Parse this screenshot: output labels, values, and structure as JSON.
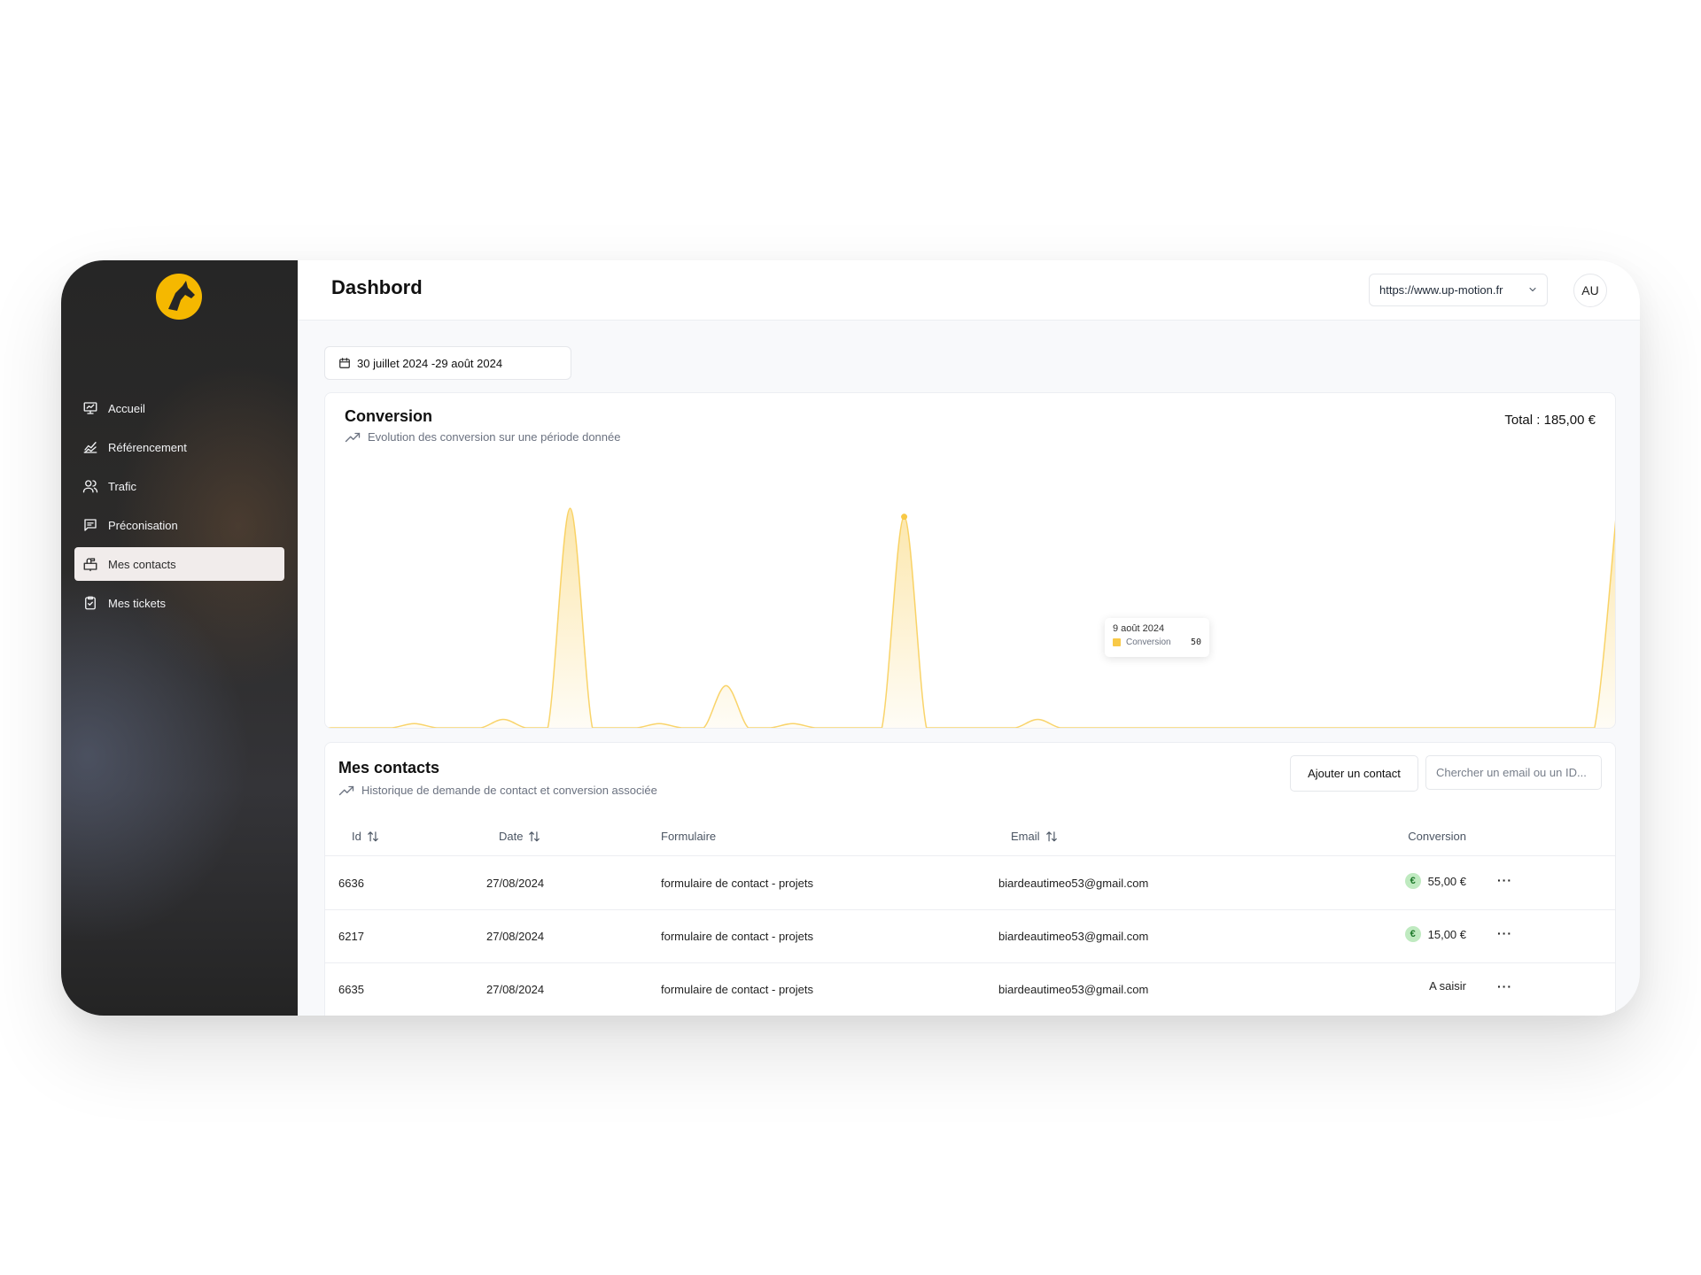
{
  "sidebar": {
    "items": [
      {
        "label": "Accueil",
        "icon": "presentation-icon"
      },
      {
        "label": "Référencement",
        "icon": "chart-line-icon"
      },
      {
        "label": "Trafic",
        "icon": "users-icon"
      },
      {
        "label": "Préconisation",
        "icon": "message-icon"
      },
      {
        "label": "Mes contacts",
        "icon": "mailbox-icon",
        "active": true
      },
      {
        "label": "Mes tickets",
        "icon": "clipboard-icon"
      }
    ]
  },
  "header": {
    "title": "Dashbord",
    "site_select": "https://www.up-motion.fr",
    "avatar": "AU"
  },
  "date_range": "30 juillet 2024 -29 août 2024",
  "conversion": {
    "title": "Conversion",
    "subtitle": "Evolution des conversion sur une période donnée",
    "total": "Total : 185,00 €",
    "tooltip": {
      "date": "9 août 2024",
      "label": "Conversion",
      "value": "50"
    }
  },
  "chart_data": {
    "type": "area",
    "series": [
      {
        "values": [
          0,
          0,
          0,
          0,
          1,
          0,
          0,
          0,
          2,
          0,
          0,
          52,
          0,
          0,
          0,
          1,
          0,
          0,
          10,
          0,
          0,
          1,
          0,
          0,
          0,
          0,
          50,
          0,
          0,
          0,
          0,
          0,
          2,
          0,
          0,
          0,
          0,
          0,
          0,
          0,
          0,
          0,
          0,
          0,
          0,
          0,
          0,
          0,
          0,
          0,
          0,
          0,
          0,
          0,
          0,
          0,
          0,
          0,
          52
        ]
      }
    ],
    "color": "#f8c947",
    "ylim": [
      0,
      60
    ],
    "grid": false,
    "highlight_index": 26
  },
  "contacts": {
    "title": "Mes contacts",
    "subtitle": "Historique de demande de contact et conversion associée",
    "add_button": "Ajouter un contact",
    "search_placeholder": "Chercher un email ou un ID...",
    "columns": {
      "id": "Id",
      "date": "Date",
      "form": "Formulaire",
      "email": "Email",
      "conversion": "Conversion"
    },
    "rows": [
      {
        "id": "6636",
        "date": "27/08/2024",
        "form": "formulaire de contact - projets",
        "email": "biardeautimeo53@gmail.com",
        "conversion": "55,00 €",
        "badge": "€"
      },
      {
        "id": "6217",
        "date": "27/08/2024",
        "form": "formulaire de contact - projets",
        "email": "biardeautimeo53@gmail.com",
        "conversion": "15,00 €",
        "badge": "€"
      },
      {
        "id": "6635",
        "date": "27/08/2024",
        "form": "formulaire de contact - projets",
        "email": "biardeautimeo53@gmail.com",
        "conversion": "A saisir",
        "badge": ""
      }
    ],
    "more_label": "···"
  }
}
